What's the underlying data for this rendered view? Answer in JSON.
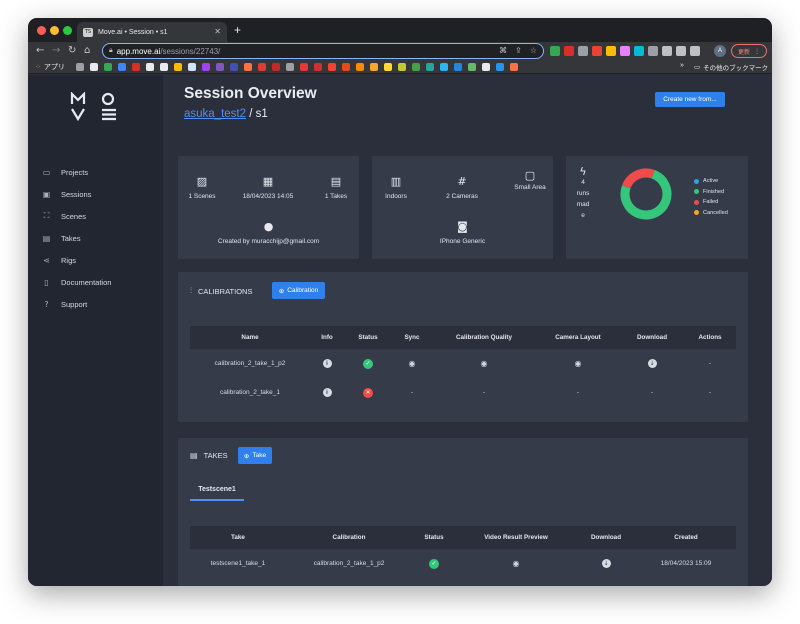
{
  "browser": {
    "tab_title": "Move.ai • Session • s1",
    "tab_favicon": "TS",
    "url_host": "app.move.ai",
    "url_path": "/sessions/22743/",
    "avatar_letter": "A",
    "update_label": "更新",
    "bookmarks_apps": "アプリ",
    "bookmarks_more": "»",
    "bookmarks_other": "その他のブックマーク"
  },
  "sidebar": {
    "logo": "MOVE",
    "items": [
      {
        "label": "Projects",
        "icon": "folder-icon"
      },
      {
        "label": "Sessions",
        "icon": "camera-icon"
      },
      {
        "label": "Scenes",
        "icon": "image-icon"
      },
      {
        "label": "Takes",
        "icon": "film-icon"
      },
      {
        "label": "Rigs",
        "icon": "share-icon"
      },
      {
        "label": "Documentation",
        "icon": "book-icon"
      },
      {
        "label": "Support",
        "icon": "help-icon"
      }
    ]
  },
  "header": {
    "title": "Session Overview",
    "project_link": "asuka_test2",
    "separator": "/",
    "session_name": "s1",
    "new_button": "Create new from..."
  },
  "stats": {
    "scenes": "1 Scenes",
    "date": "18/04/2023 14:05",
    "takes": "1 Takes",
    "created_by": "Created by muracchijp@gmail.com",
    "location": "Indoors",
    "cameras": "2 Cameras",
    "area": "Small Area",
    "camera_model": "IPhone Generic",
    "runs_lines": [
      "4",
      "runs",
      "mad",
      "e"
    ]
  },
  "runs_chart": {
    "legend": [
      "Active",
      "Finished",
      "Failed",
      "Cancelled"
    ],
    "colors": {
      "Active": "#2aa7e0",
      "Finished": "#34c77b",
      "Failed": "#ef4b4b",
      "Cancelled": "#f6a623"
    },
    "values": {
      "Active": 0,
      "Finished": 3,
      "Failed": 1,
      "Cancelled": 0
    }
  },
  "calibrations": {
    "title": "CALIBRATIONS",
    "add_button": "Calibration",
    "columns": [
      "Name",
      "Info",
      "Status",
      "Sync",
      "Calibration Quality",
      "Camera Layout",
      "Download",
      "Actions"
    ],
    "rows": [
      {
        "name": "calibration_2_take_1_p2",
        "status": "ok",
        "sync": "view",
        "quality": "view",
        "layout": "view",
        "download": "download",
        "actions": "-"
      },
      {
        "name": "calibration_2_take_1",
        "status": "error",
        "sync": "-",
        "quality": "-",
        "layout": "-",
        "download": "-",
        "actions": "-"
      }
    ]
  },
  "takes": {
    "title": "TAKES",
    "add_button": "Take",
    "scene_tab": "Testscene1",
    "columns": [
      "Take",
      "Calibration",
      "Status",
      "Video Result Preview",
      "Download",
      "Created"
    ],
    "rows": [
      {
        "take": "testscene1_take_1",
        "calibration": "calibration_2_take_1_p2",
        "status": "ok",
        "created": "18/04/2023 15:09"
      }
    ]
  }
}
